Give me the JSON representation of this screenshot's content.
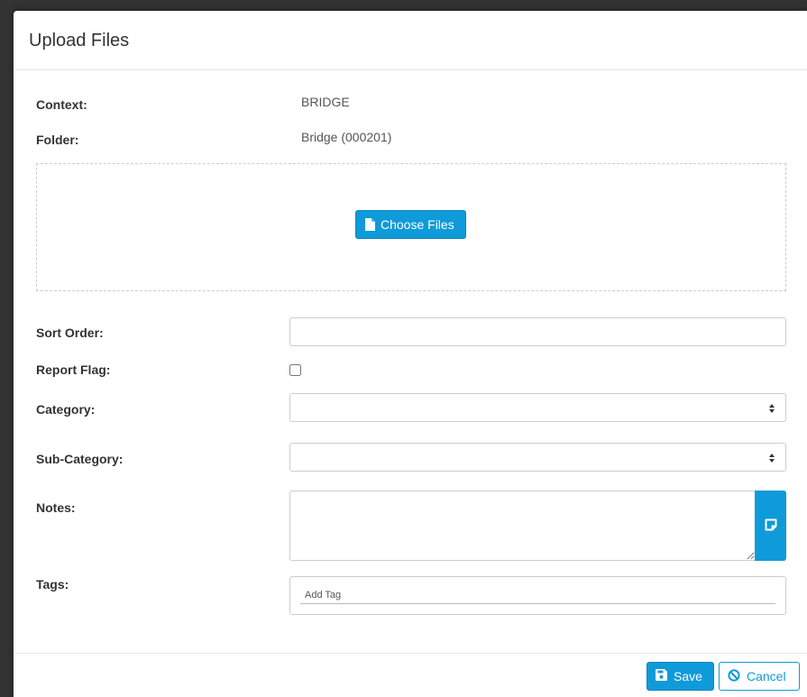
{
  "modal": {
    "title": "Upload Files"
  },
  "info": {
    "context_label": "Context:",
    "context_value": "BRIDGE",
    "folder_label": "Folder:",
    "folder_value": "Bridge (000201)"
  },
  "dropzone": {
    "choose_files_label": "Choose Files",
    "choose_files_icon": "file-icon"
  },
  "form": {
    "sort_order_label": "Sort Order:",
    "sort_order_value": "",
    "report_flag_label": "Report Flag:",
    "report_flag_checked": false,
    "category_label": "Category:",
    "category_value": "",
    "subcategory_label": "Sub-Category:",
    "subcategory_value": "",
    "notes_label": "Notes:",
    "notes_value": "",
    "notes_button_icon": "sticky-note-icon",
    "tags_label": "Tags:",
    "tags_placeholder": "Add Tag"
  },
  "footer": {
    "save_label": "Save",
    "save_icon": "floppy-disk-icon",
    "cancel_label": "Cancel",
    "cancel_icon": "ban-icon"
  },
  "colors": {
    "accent": "#0f9ad9",
    "backdrop": "#333333"
  }
}
